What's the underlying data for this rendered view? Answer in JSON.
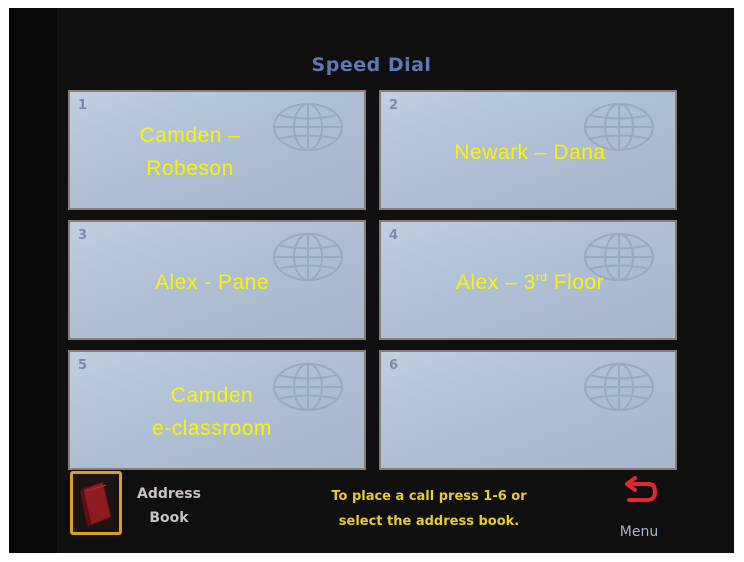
{
  "title": "Speed Dial",
  "tiles": [
    {
      "number": "1",
      "label_line1": "Camden –",
      "label_line2": "Robeson"
    },
    {
      "number": "2",
      "label_line1": "Newark – Dana",
      "label_line2": ""
    },
    {
      "number": "3",
      "label_line1": "Alex - Pane",
      "label_line2": ""
    },
    {
      "number": "4",
      "label_prefix": "Alex – 3",
      "label_sup": "rd",
      "label_suffix": " Floor"
    },
    {
      "number": "5",
      "label_line1": "Camden",
      "label_line2": "e-classroom"
    },
    {
      "number": "6",
      "label_line1": "",
      "label_line2": ""
    }
  ],
  "footer": {
    "address_book_line1": "Address",
    "address_book_line2": "Book",
    "instructions_line1": "To place a call press 1-6 or",
    "instructions_line2": "select the address book.",
    "menu_label": "Menu"
  },
  "icons": {
    "tile_icon": "globe-icon",
    "address_book_icon": "book-icon",
    "menu_icon": "return-arrow-icon"
  },
  "colors": {
    "title": "#5f77b5",
    "tile_label": "#fdf200",
    "instructions": "#e8cb2e",
    "book_border": "#d9a11d",
    "menu_arrow": "#e0282c"
  }
}
